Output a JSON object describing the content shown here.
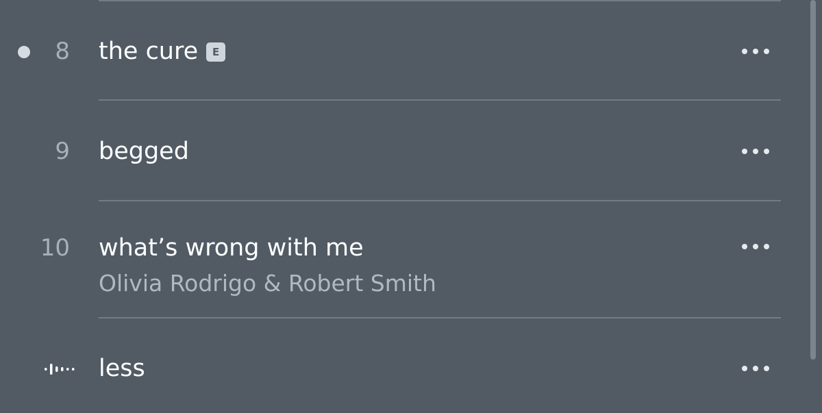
{
  "colors": {
    "background": "#525b64",
    "title_text": "#ffffff",
    "secondary_text": "#b0b8c0",
    "track_number": "#a8b0b8",
    "divider": "#737c85",
    "unplayed_dot": "#d5dde3",
    "explicit_badge_bg": "#cfd6dc",
    "explicit_badge_text": "#525b64"
  },
  "tracks": [
    {
      "number": "8",
      "title": "the cure",
      "explicit": true,
      "explicit_label": "E",
      "unplayed_indicator": true,
      "more_icon": "ellipsis-icon"
    },
    {
      "number": "9",
      "title": "begged",
      "explicit": false,
      "more_icon": "ellipsis-icon"
    },
    {
      "number": "10",
      "title": "what’s wrong with me",
      "artist": "Olivia Rodrigo & Robert Smith",
      "explicit": false,
      "more_icon": "ellipsis-icon"
    },
    {
      "title": "less",
      "now_playing": true,
      "status_icon": "now-playing-waveform-icon",
      "more_icon": "ellipsis-icon"
    }
  ]
}
